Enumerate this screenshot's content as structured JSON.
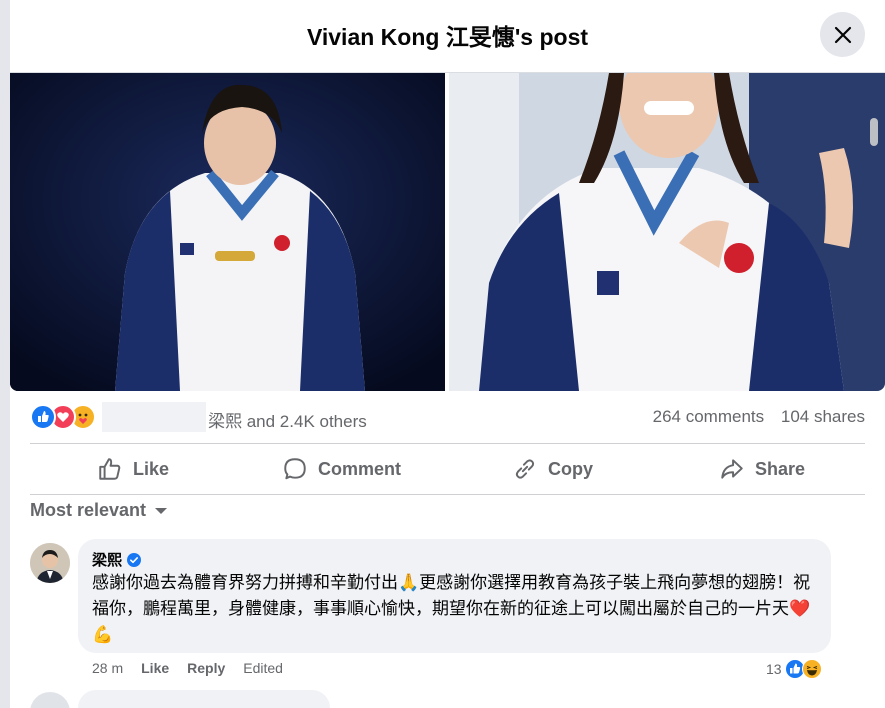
{
  "header": {
    "title": "Vivian Kong 江旻憓's post"
  },
  "photos": {
    "left_alt": "Athlete looking at a gold medal",
    "right_alt": "Athlete smiling with hand on chest"
  },
  "stats": {
    "reactors_text": "梁熙 and 2.4K others",
    "comments": "264 comments",
    "shares": "104 shares",
    "reaction_icons": [
      "like-icon",
      "love-icon",
      "care-icon"
    ]
  },
  "actions": {
    "like": "Like",
    "comment": "Comment",
    "copy": "Copy",
    "share": "Share"
  },
  "sort": {
    "label": "Most relevant"
  },
  "comment": {
    "author": "梁熙",
    "verified": true,
    "text": "感謝你過去為體育界努力拼搏和辛勤付出🙏更感謝你選擇用教育為孩子裝上飛向夢想的翅膀！祝福你，鵬程萬里，身體健康，事事順心愉快，期望你在新的征途上可以闖出屬於自己的一片天❤️💪",
    "time": "28 m",
    "like": "Like",
    "reply": "Reply",
    "edited": "Edited",
    "reaction_count": "13"
  },
  "colors": {
    "accent": "#1877f2",
    "text": "#050505",
    "secondary": "#65676b",
    "love": "#f33e58",
    "haha": "#f7b125"
  }
}
